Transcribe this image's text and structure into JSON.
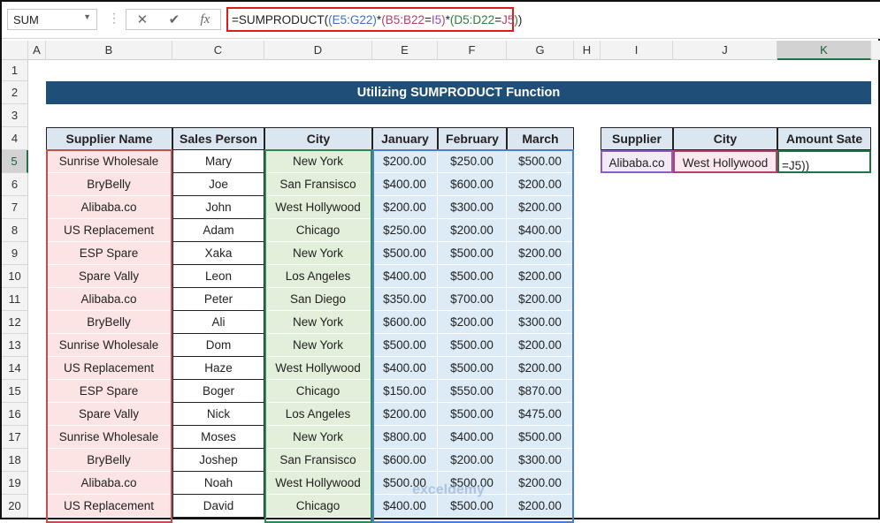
{
  "name_box": "SUM",
  "formula_parts": [
    {
      "t": "=SUMPRODUCT(",
      "c": "#222"
    },
    {
      "t": "(",
      "c": "#3a6fc9"
    },
    {
      "t": "E5:G22",
      "c": "#3a6fc9"
    },
    {
      "t": ")",
      "c": "#3a6fc9"
    },
    {
      "t": "*",
      "c": "#222"
    },
    {
      "t": "(",
      "c": "#b4406a"
    },
    {
      "t": "B5:B22",
      "c": "#b4406a"
    },
    {
      "t": "=",
      "c": "#222"
    },
    {
      "t": "I5",
      "c": "#8e4fb8"
    },
    {
      "t": ")",
      "c": "#b4406a"
    },
    {
      "t": "*",
      "c": "#222"
    },
    {
      "t": "(",
      "c": "#2e7d3a"
    },
    {
      "t": "D5:D22",
      "c": "#2e7d3a"
    },
    {
      "t": "=",
      "c": "#222"
    },
    {
      "t": "J5",
      "c": "#b4406a"
    },
    {
      "t": ")",
      "c": "#2e7d3a"
    },
    {
      "t": ")",
      "c": "#222"
    }
  ],
  "columns": [
    "A",
    "B",
    "C",
    "D",
    "E",
    "F",
    "G",
    "H",
    "I",
    "J",
    "K"
  ],
  "rows": [
    "1",
    "2",
    "3",
    "4",
    "5",
    "6",
    "7",
    "8",
    "9",
    "10",
    "11",
    "12",
    "13",
    "14",
    "15",
    "16",
    "17",
    "18",
    "19",
    "20"
  ],
  "title": "Utilizing SUMPRODUCT Function",
  "table_headers": [
    "Supplier Name",
    "Sales Person",
    "City",
    "January",
    "February",
    "March"
  ],
  "table_rows": [
    [
      "Sunrise Wholesale",
      "Mary",
      "New York",
      "$200.00",
      "$250.00",
      "$500.00"
    ],
    [
      "BryBelly",
      "Joe",
      "San Fransisco",
      "$400.00",
      "$600.00",
      "$200.00"
    ],
    [
      "Alibaba.co",
      "John",
      "West Hollywood",
      "$200.00",
      "$300.00",
      "$200.00"
    ],
    [
      "US Replacement",
      "Adam",
      "Chicago",
      "$250.00",
      "$200.00",
      "$400.00"
    ],
    [
      "ESP Spare",
      "Xaka",
      "New York",
      "$500.00",
      "$500.00",
      "$200.00"
    ],
    [
      "Spare Vally",
      "Leon",
      "Los Angeles",
      "$400.00",
      "$500.00",
      "$200.00"
    ],
    [
      "Alibaba.co",
      "Peter",
      "San Diego",
      "$350.00",
      "$700.00",
      "$200.00"
    ],
    [
      "BryBelly",
      "Ali",
      "New York",
      "$600.00",
      "$200.00",
      "$300.00"
    ],
    [
      "Sunrise Wholesale",
      "Dom",
      "New York",
      "$500.00",
      "$500.00",
      "$200.00"
    ],
    [
      "US Replacement",
      "Haze",
      "West Hollywood",
      "$400.00",
      "$500.00",
      "$200.00"
    ],
    [
      "ESP Spare",
      "Boger",
      "Chicago",
      "$150.00",
      "$550.00",
      "$870.00"
    ],
    [
      "Spare Vally",
      "Nick",
      "Los Angeles",
      "$200.00",
      "$500.00",
      "$475.00"
    ],
    [
      "Sunrise Wholesale",
      "Moses",
      "New York",
      "$800.00",
      "$400.00",
      "$500.00"
    ],
    [
      "BryBelly",
      "Joshep",
      "San Fransisco",
      "$600.00",
      "$200.00",
      "$300.00"
    ],
    [
      "Alibaba.co",
      "Noah",
      "West Hollywood",
      "$500.00",
      "$500.00",
      "$200.00"
    ],
    [
      "US Replacement",
      "David",
      "Chicago",
      "$400.00",
      "$500.00",
      "$200.00"
    ]
  ],
  "lookup": {
    "headers": [
      "Supplier",
      "City",
      "Amount Sate"
    ],
    "supplier": "Alibaba.co",
    "city": "West Hollywood",
    "amount_edit": "=J5))"
  },
  "watermark": "exceldemy"
}
